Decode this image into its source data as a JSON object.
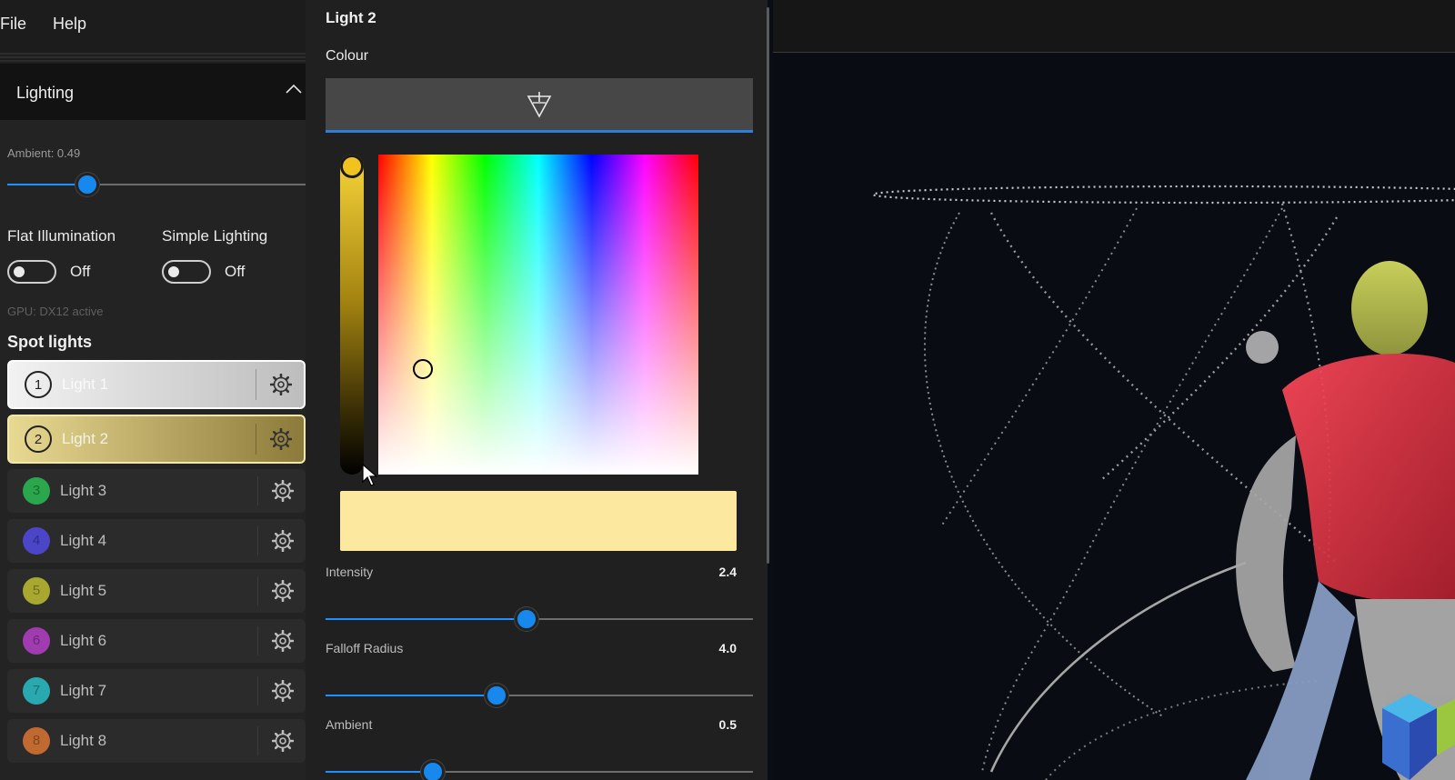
{
  "menu": {
    "file": "File",
    "help": "Help"
  },
  "left_panel": {
    "section_title": "Lighting",
    "ambient_label": "Ambient: 0.49",
    "ambient_value": 0.49,
    "flat_illumination": {
      "label": "Flat Illumination",
      "state": "Off"
    },
    "simple_lighting": {
      "label": "Simple Lighting",
      "state": "Off"
    },
    "gpu_status": "GPU: DX12 active",
    "spot_title": "Spot lights",
    "lights": [
      {
        "num": "1",
        "label": "Light 1",
        "color": "#e4e4e4",
        "selected": true
      },
      {
        "num": "2",
        "label": "Light 2",
        "color": "#e0c878",
        "selected": true
      },
      {
        "num": "3",
        "label": "Light 3",
        "color": "#2aa64c",
        "selected": false
      },
      {
        "num": "4",
        "label": "Light 4",
        "color": "#4b45c8",
        "selected": false
      },
      {
        "num": "5",
        "label": "Light 5",
        "color": "#a8a830",
        "selected": false
      },
      {
        "num": "6",
        "label": "Light 6",
        "color": "#a03cb0",
        "selected": false
      },
      {
        "num": "7",
        "label": "Light 7",
        "color": "#2aa8b0",
        "selected": false
      },
      {
        "num": "8",
        "label": "Light 8",
        "color": "#c06a32",
        "selected": false
      }
    ]
  },
  "light_panel": {
    "title": "Light 2",
    "colour_label": "Colour",
    "selected_color": "#fde8a0",
    "brightness_fraction": 1.0,
    "picker_hue_fraction": 0.14,
    "picker_whiteness_fraction": 0.67,
    "intensity": {
      "label": "Intensity",
      "value": "2.4",
      "fraction": 0.47
    },
    "falloff": {
      "label": "Falloff Radius",
      "value": "4.0",
      "fraction": 0.4
    },
    "ambient": {
      "label": "Ambient",
      "value": "0.5",
      "fraction": 0.25
    }
  },
  "colors": {
    "accent": "#1688ee",
    "panel": "#232323",
    "viewport_bg": "#0a0c14"
  }
}
